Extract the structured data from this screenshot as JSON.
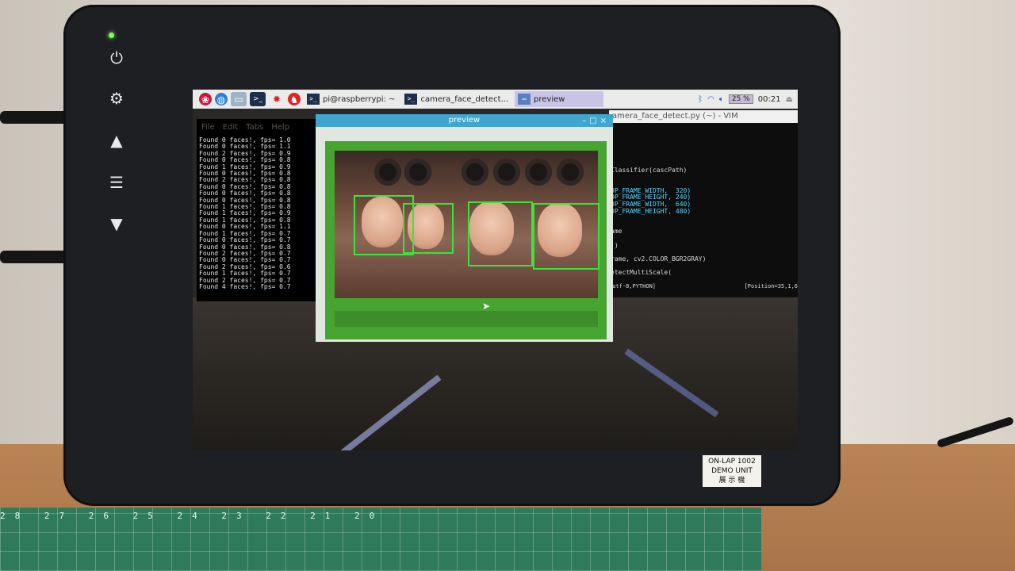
{
  "taskbar": {
    "apps": [
      {
        "label": "pi@raspberrypi: ~",
        "active": false
      },
      {
        "label": "camera_face_detect...",
        "active": false
      },
      {
        "label": "preview",
        "active": true
      }
    ],
    "cpu": "25 %",
    "clock": "00:21"
  },
  "terminal": {
    "menu": [
      "File",
      "Edit",
      "Tabs",
      "Help"
    ],
    "lines": [
      "Found 0 faces!, fps= 1.0",
      "Found 0 faces!, fps= 1.1",
      "Found 2 faces!, fps= 0.9",
      "Found 0 faces!, fps= 0.8",
      "Found 1 faces!, fps= 0.9",
      "Found 0 faces!, fps= 0.8",
      "Found 2 faces!, fps= 0.8",
      "Found 0 faces!, fps= 0.8",
      "Found 0 faces!, fps= 0.8",
      "Found 0 faces!, fps= 0.8",
      "Found 1 faces!, fps= 0.8",
      "Found 1 faces!, fps= 0.9",
      "Found 1 faces!, fps= 0.8",
      "Found 0 faces!, fps= 1.1",
      "Found 1 faces!, fps= 0.7",
      "Found 0 faces!, fps= 0.7",
      "Found 0 faces!, fps= 0.8",
      "Found 2 faces!, fps= 0.7",
      "Found 0 faces!, fps= 0.7",
      "Found 2 faces!, fps= 0.6",
      "Found 1 faces!, fps= 0.7",
      "Found 2 faces!, fps= 0.7",
      "Found 4 faces!, fps= 0.7"
    ]
  },
  "vim": {
    "title": "amera_face_detect.py (~) - VIM",
    "lines": [
      "Classifier(cascPath)",
      "",
      "",
      "OP_FRAME_WIDTH,  320)",
      "OP_FRAME_HEIGHT, 240)",
      "OP_FRAME_WIDTH,  640)",
      "OP_FRAME_HEIGHT, 480)",
      "",
      "",
      "ame",
      "",
      "()",
      "",
      "rame, cv2.COLOR_BGR2GRAY)",
      "",
      "etectMultiScale("
    ],
    "status_left": ",utf-8,PYTHON]",
    "status_right": "[Position=35,1,6"
  },
  "preview": {
    "title": "preview",
    "faces_detected": 4
  },
  "device": {
    "badge_line1": "ON-LAP 1002",
    "badge_line2": "DEMO UNIT",
    "badge_line3": "展 示 機"
  },
  "mat": {
    "ruler": "28 27 26 25 24 23 22 21 20"
  },
  "colors": {
    "taskbar": "#ebebeb",
    "preview_titlebar": "#40a6cf",
    "detection_box": "#3be43b",
    "frame_green": "#47a431"
  }
}
